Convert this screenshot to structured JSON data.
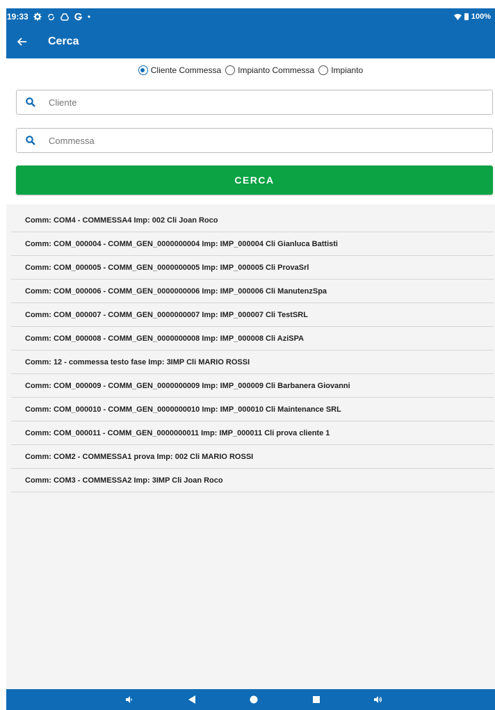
{
  "status_bar": {
    "time": "19:33",
    "battery": "100%"
  },
  "app_bar": {
    "title": "Cerca"
  },
  "search_type": {
    "options": [
      "Cliente Commessa",
      "Impianto Commessa",
      "Impianto"
    ],
    "selected": "Cliente Commessa"
  },
  "fields": {
    "cliente_placeholder": "Cliente",
    "commessa_placeholder": "Commessa"
  },
  "button": {
    "label": "CERCA"
  },
  "results": [
    "Comm: COM4 - COMMESSA4 Imp: 002 Cli Joan Roco",
    "Comm: COM_000004 - COMM_GEN_0000000004 Imp: IMP_000004 Cli Gianluca Battisti",
    "Comm: COM_000005 - COMM_GEN_0000000005 Imp: IMP_000005 Cli ProvaSrl",
    "Comm: COM_000006 - COMM_GEN_0000000006 Imp: IMP_000006 Cli ManutenzSpa",
    "Comm: COM_000007 - COMM_GEN_0000000007 Imp: IMP_000007 Cli TestSRL",
    "Comm: COM_000008 - COMM_GEN_0000000008 Imp: IMP_000008 Cli AziSPA",
    "Comm: 12 - commessa testo fase Imp: 3IMP Cli MARIO ROSSI",
    "Comm: COM_000009 - COMM_GEN_0000000009 Imp: IMP_000009 Cli Barbanera Giovanni",
    "Comm: COM_000010 - COMM_GEN_0000000010 Imp: IMP_000010 Cli Maintenance SRL",
    "Comm: COM_000011 - COMM_GEN_0000000011 Imp: IMP_000011 Cli prova cliente 1",
    "Comm: COM2 - COMMESSA1 prova Imp: 002 Cli MARIO ROSSI",
    "Comm: COM3 - COMMESSA2 Imp: 3IMP Cli Joan Roco"
  ],
  "colors": {
    "primary": "#0f6bb5",
    "button": "#0ba344",
    "list_bg": "#f4f4f4"
  },
  "icons": {
    "status": [
      "settings-icon",
      "sync-icon",
      "drive-icon",
      "google-icon",
      "dot-icon",
      "wifi-icon",
      "battery-icon"
    ],
    "nav": [
      "volume-down-icon",
      "back-triangle-icon",
      "home-circle-icon",
      "recents-square-icon",
      "volume-up-icon"
    ]
  }
}
